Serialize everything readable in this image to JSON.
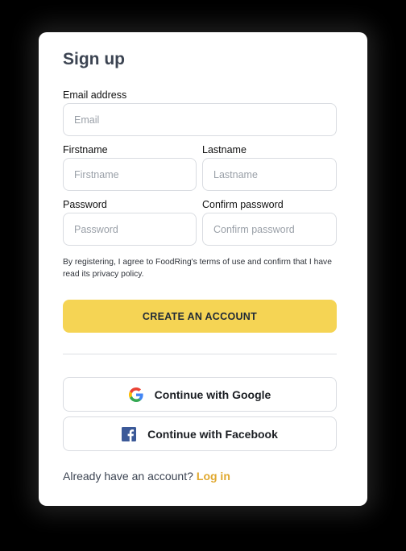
{
  "form": {
    "title": "Sign up",
    "email": {
      "label": "Email address",
      "placeholder": "Email",
      "value": ""
    },
    "firstname": {
      "label": "Firstname",
      "placeholder": "Firstname",
      "value": ""
    },
    "lastname": {
      "label": "Lastname",
      "placeholder": "Lastname",
      "value": ""
    },
    "password": {
      "label": "Password",
      "placeholder": "Password",
      "value": ""
    },
    "confirm_password": {
      "label": "Confirm password",
      "placeholder": "Confirm password",
      "value": ""
    },
    "terms": "By registering, I agree to FoodRing's terms of use and confirm that I have read its privacy policy.",
    "submit_label": "CREATE AN ACCOUNT"
  },
  "social": {
    "google_label": "Continue with Google",
    "facebook_label": "Continue with Facebook",
    "google_icon": "google-icon",
    "facebook_icon": "facebook-icon"
  },
  "footer": {
    "prompt": "Already have an account?",
    "login_label": "Log in"
  },
  "colors": {
    "primary_button": "#f5d454",
    "link": "#e0a82e",
    "facebook": "#3b5998",
    "title": "#3c4452"
  }
}
